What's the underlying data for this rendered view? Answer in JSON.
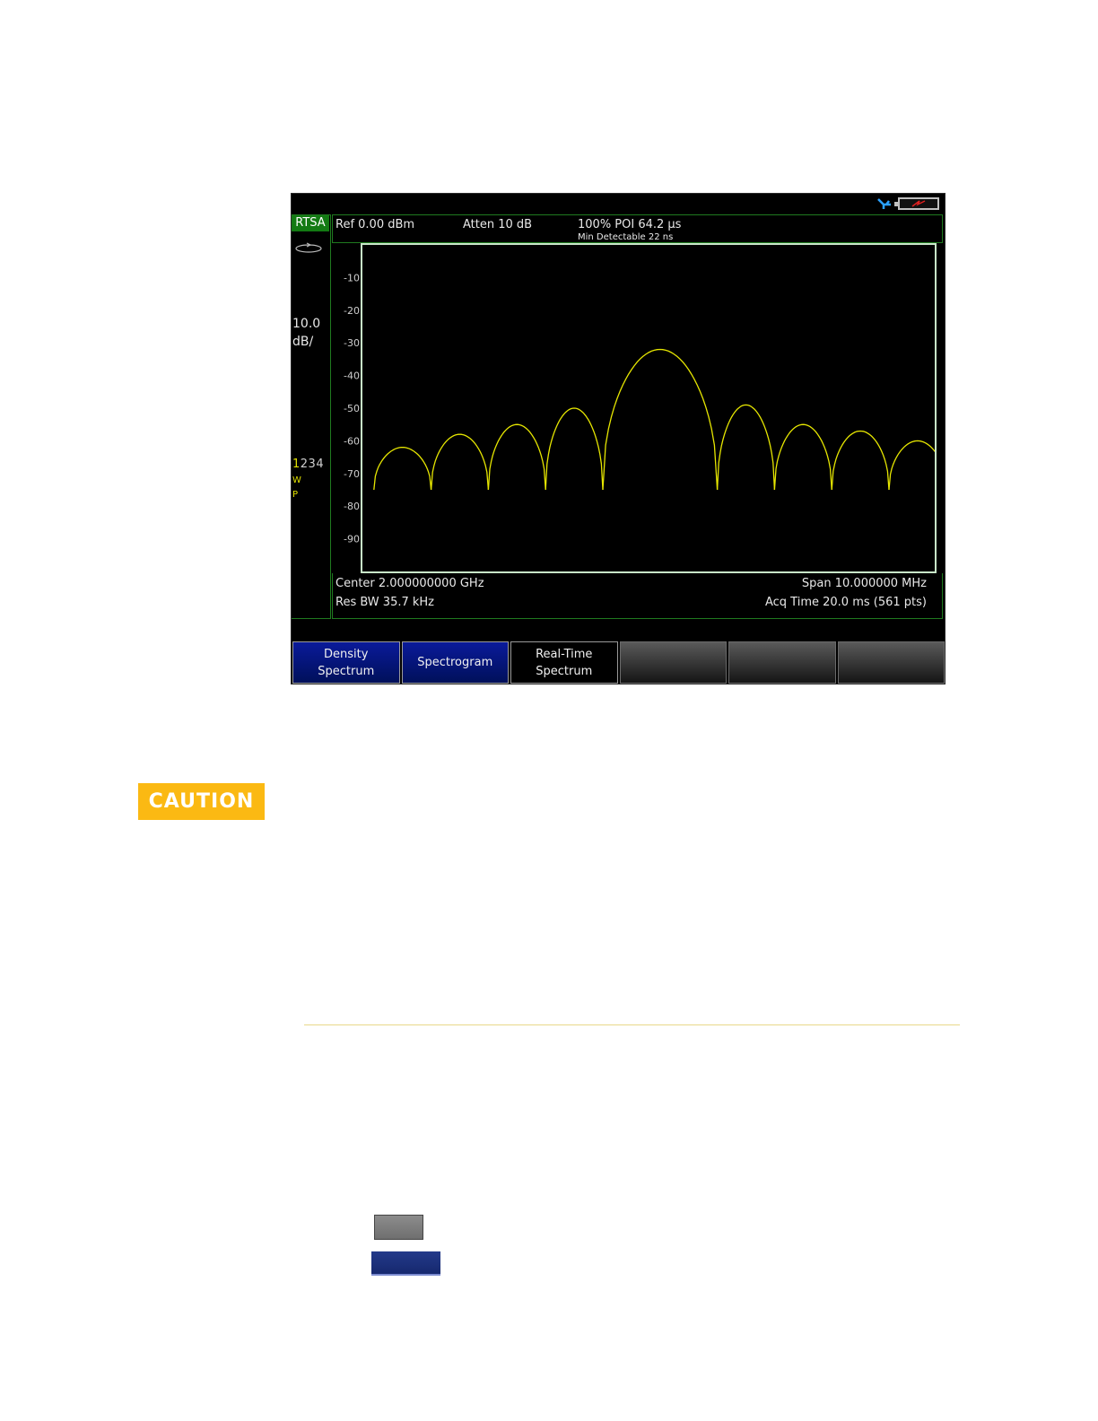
{
  "screen": {
    "mode": "RTSA",
    "header": {
      "ref": "Ref 0.00 dBm",
      "atten": "Atten 10 dB",
      "poi": "100% POI 64.2 μs",
      "min_detectable": "Min Detectable 22 ns"
    },
    "scale": {
      "value": "10.0",
      "unit": "dB/"
    },
    "traces": {
      "active": "1",
      "others": "234",
      "w": "W",
      "p": "P"
    },
    "footer": {
      "center": "Center 2.000000000 GHz",
      "res_bw": "Res BW 35.7 kHz",
      "span": "Span 10.000000 MHz",
      "acq_time": "Acq Time 20.0 ms (561 pts)"
    },
    "softkeys": [
      {
        "label": "Density\nSpectrum",
        "style": "blue"
      },
      {
        "label": "Spectrogram",
        "style": "blue"
      },
      {
        "label": "Real-Time\nSpectrum",
        "style": "black"
      },
      {
        "label": "",
        "style": "blank"
      },
      {
        "label": "",
        "style": "blank"
      },
      {
        "label": "",
        "style": "blank"
      }
    ],
    "icons": [
      "usb-icon",
      "battery-icon",
      "sweep-icon"
    ]
  },
  "chart_data": {
    "type": "line",
    "ylim": [
      0,
      -100
    ],
    "y_ticks": [
      "-10",
      "-20",
      "-30",
      "-40",
      "-50",
      "-60",
      "-70",
      "-80",
      "-90"
    ],
    "xlim": [
      1995,
      2005
    ],
    "trace_color": "#e6e600",
    "grid": false,
    "series": [
      {
        "lobes": [
          {
            "x_start": 1995.2,
            "x_end": 1996.2,
            "peak_db": -62
          },
          {
            "x_start": 1996.2,
            "x_end": 1997.2,
            "peak_db": -58
          },
          {
            "x_start": 1997.2,
            "x_end": 1998.2,
            "peak_db": -55
          },
          {
            "x_start": 1998.2,
            "x_end": 1999.2,
            "peak_db": -50
          },
          {
            "x_start": 1999.2,
            "x_end": 2001.2,
            "peak_db": -32
          },
          {
            "x_start": 2001.2,
            "x_end": 2002.2,
            "peak_db": -49
          },
          {
            "x_start": 2002.2,
            "x_end": 2003.2,
            "peak_db": -55
          },
          {
            "x_start": 2003.2,
            "x_end": 2004.2,
            "peak_db": -57
          },
          {
            "x_start": 2004.2,
            "x_end": 2005.2,
            "peak_db": -60
          }
        ],
        "null_db": -75
      }
    ]
  },
  "caution": {
    "label": "CAUTION",
    "color": "#fbb913"
  }
}
